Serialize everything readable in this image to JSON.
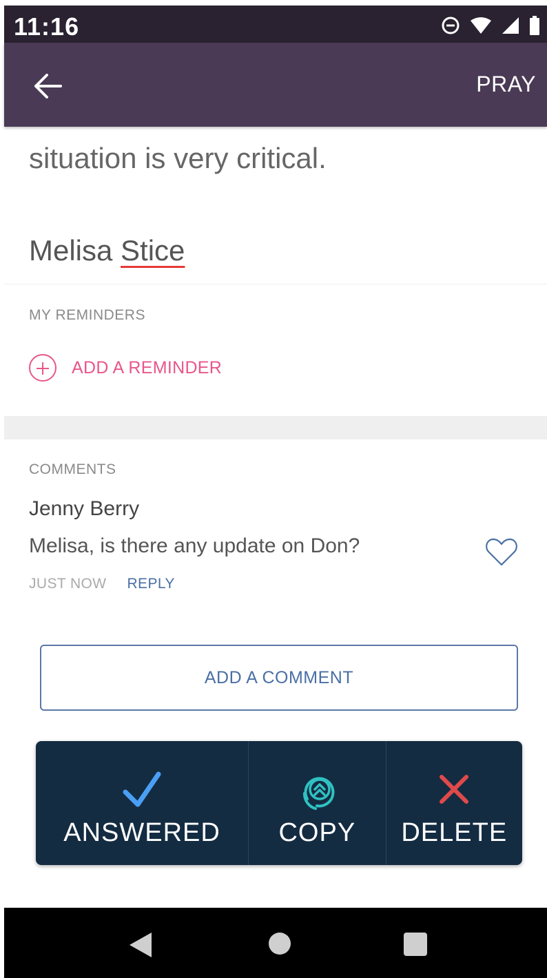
{
  "status_bar": {
    "time": "11:16",
    "icons": [
      "do-not-disturb-icon",
      "wifi-icon",
      "cell-signal-icon",
      "battery-icon"
    ]
  },
  "app_bar": {
    "back_icon": "arrow-left-icon",
    "action_label": "PRAY",
    "background": "#4a3a55"
  },
  "prayer": {
    "text_fragment": "situation is very critical.",
    "author_first": "Melisa",
    "author_last": "Stice"
  },
  "reminders": {
    "section_label": "MY REMINDERS",
    "add_label": "ADD A REMINDER",
    "accent": "#e8568a"
  },
  "comments": {
    "section_label": "COMMENTS",
    "items": [
      {
        "author": "Jenny Berry",
        "text": "Melisa, is there any update on Don?",
        "time": "JUST NOW",
        "reply_label": "REPLY",
        "icon": "heart-outline-icon"
      }
    ],
    "add_comment_label": "ADD A COMMENT"
  },
  "actions": {
    "answered": {
      "label": "ANSWERED",
      "icon": "checkmark-icon",
      "color": "#4a9ff5"
    },
    "copy": {
      "label": "COPY",
      "icon": "copy-chevrons-icon",
      "color": "#2fc2c2"
    },
    "delete": {
      "label": "DELETE",
      "icon": "x-icon",
      "color": "#e04a4a"
    }
  },
  "nav_bar": {
    "icons": [
      "back-triangle-icon",
      "home-circle-icon",
      "recents-square-icon"
    ]
  }
}
